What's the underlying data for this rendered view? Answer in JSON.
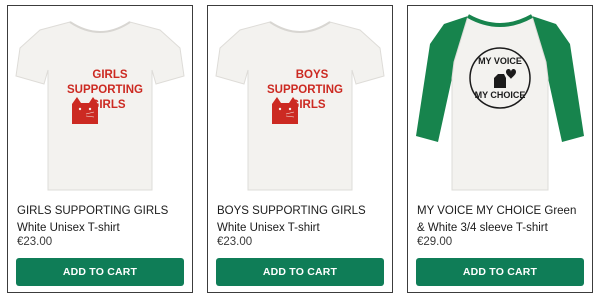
{
  "colors": {
    "button_green": "#0f7d57",
    "print_red": "#cc2a22",
    "sleeve_green": "#17844d",
    "shirt_white": "#f3f2ef"
  },
  "products": [
    {
      "image": {
        "icon": "cat-icon",
        "print_lines": [
          "GIRLS",
          "SUPPORTING",
          "GIRLS"
        ]
      },
      "title": "GIRLS SUPPORTING GIRLS White Unisex T-shirt",
      "price": "€23.00",
      "button_label": "ADD TO CART"
    },
    {
      "image": {
        "icon": "cat-icon",
        "print_lines": [
          "BOYS",
          "SUPPORTING",
          "GIRLS"
        ]
      },
      "title": "BOYS SUPPORTING GIRLS White Unisex T-shirt",
      "price": "€23.00",
      "button_label": "ADD TO CART"
    },
    {
      "image": {
        "icon": "heart-hand-icon",
        "print_lines": [
          "MY VOICE",
          "MY CHOICE"
        ]
      },
      "title": "MY VOICE MY CHOICE Green & White 3/4 sleeve T-shirt",
      "price": "€29.00",
      "button_label": "ADD TO CART"
    }
  ]
}
